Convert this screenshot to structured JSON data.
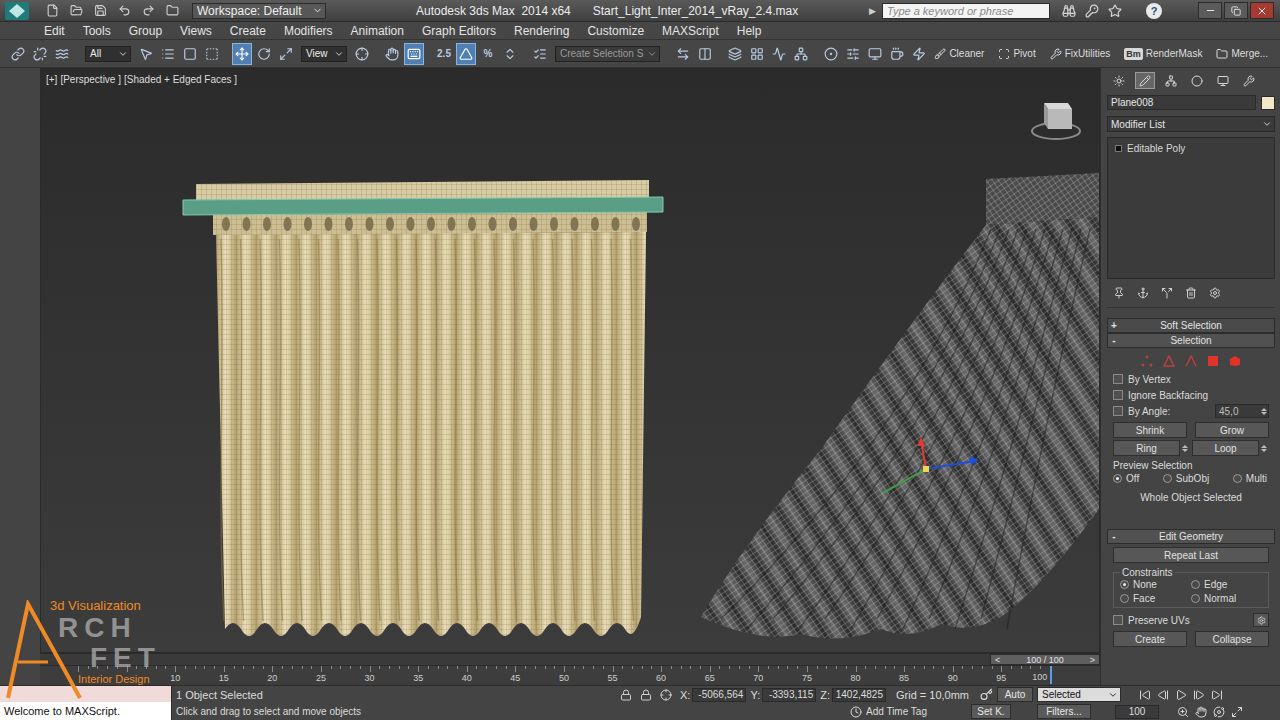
{
  "title_bar": {
    "workspace": "Workspace: Default",
    "app": "Autodesk 3ds Max  2014 x64",
    "file": "Start_Light_Inter_2014_vRay_2.4.max",
    "search_arrow": "▶",
    "search_placeholder": "Type a keyword or phrase",
    "help": "?"
  },
  "menu": [
    "Edit",
    "Tools",
    "Group",
    "Views",
    "Create",
    "Modifiers",
    "Animation",
    "Graph Editors",
    "Rendering",
    "Customize",
    "MAXScript",
    "Help"
  ],
  "toolbar": {
    "groups": [
      [
        {
          "kind": "icon",
          "selected": false
        },
        {
          "kind": "icon",
          "selected": false
        },
        {
          "kind": "icon",
          "selected": false
        }
      ],
      [
        {
          "kind": "dropdown",
          "label": "All"
        },
        {
          "kind": "icon",
          "selected": false
        },
        {
          "kind": "icon",
          "selected": false
        },
        {
          "kind": "icon",
          "selected": false
        },
        {
          "kind": "icon",
          "selected": false
        }
      ],
      [
        {
          "kind": "icon",
          "selected": true
        },
        {
          "kind": "icon",
          "selected": false
        },
        {
          "kind": "icon",
          "selected": false
        },
        {
          "kind": "dropdown",
          "label": "View"
        },
        {
          "kind": "icon",
          "selected": false
        }
      ],
      [
        {
          "kind": "icon",
          "selected": false
        },
        {
          "kind": "icon",
          "selected": true
        }
      ],
      [
        {
          "kind": "icon-text",
          "label": "2.5",
          "selected": false
        },
        {
          "kind": "icon",
          "selected": true
        },
        {
          "kind": "icon-text",
          "label": "%",
          "selected": false
        },
        {
          "kind": "icon",
          "selected": false
        }
      ],
      [
        {
          "kind": "icon",
          "selected": false
        },
        {
          "kind": "field",
          "label": "Create Selection S"
        }
      ],
      [
        {
          "kind": "icon",
          "selected": false
        },
        {
          "kind": "icon",
          "selected": false
        }
      ],
      [
        {
          "kind": "icon",
          "selected": false
        },
        {
          "kind": "icon",
          "selected": false
        },
        {
          "kind": "icon",
          "selected": false
        },
        {
          "kind": "icon",
          "selected": false
        }
      ],
      [
        {
          "kind": "icon",
          "selected": false
        },
        {
          "kind": "icon",
          "selected": false
        },
        {
          "kind": "icon",
          "selected": false
        },
        {
          "kind": "icon",
          "selected": false
        },
        {
          "kind": "icon",
          "selected": false
        }
      ]
    ],
    "plugins": [
      {
        "label": "Cleaner"
      },
      {
        "label": "Pivot"
      },
      {
        "label": "FixUtilities"
      },
      {
        "label": "RenderMask",
        "badge": "Bm"
      },
      {
        "label": "Merge..."
      }
    ]
  },
  "viewport": {
    "labels": [
      "[+]",
      "[Perspective ]",
      "[Shaded + Edged Faces ]"
    ]
  },
  "watermark": {
    "tagline": "3d Visualization",
    "line1": "RCH",
    "line2": "FET",
    "subtitle": "Interior Design"
  },
  "command_panel": {
    "tabs": [
      {
        "selected": false
      },
      {
        "selected": true
      },
      {
        "selected": false
      },
      {
        "selected": false
      },
      {
        "selected": false
      },
      {
        "selected": false
      }
    ],
    "object_name": "Plane008",
    "object_color": "#f3e8c8",
    "modifier_list": "Modifier List",
    "stack": [
      {
        "label": "Editable Poly",
        "selected": false
      }
    ],
    "soft_selection": {
      "sign": "+",
      "title": "Soft Selection",
      "expanded": false
    },
    "selection": {
      "sign": "-",
      "title": "Selection",
      "expanded": true,
      "subobjects": [
        {
          "selected": false
        },
        {
          "selected": false
        },
        {
          "selected": false
        },
        {
          "selected": false
        },
        {
          "selected": false
        }
      ],
      "options": [
        {
          "label": "By Vertex",
          "checked": false
        },
        {
          "label": "Ignore Backfacing",
          "checked": false
        },
        {
          "label": "By Angle:",
          "checked": false,
          "value": "45,0"
        }
      ],
      "grow_buttons": [
        "Shrink",
        "Grow"
      ],
      "loop_buttons": [
        "Ring",
        "Loop"
      ],
      "preview_label": "Preview Selection",
      "preview": [
        {
          "label": "Off",
          "selected": true
        },
        {
          "label": "SubObj",
          "selected": false
        },
        {
          "label": "Multi",
          "selected": false
        }
      ],
      "status": "Whole Object Selected"
    },
    "edit_geometry": {
      "sign": "-",
      "title": "Edit Geometry",
      "expanded": true,
      "repeat": "Repeat Last",
      "constraints_label": "Constraints",
      "constraints": [
        {
          "label": "None",
          "selected": true
        },
        {
          "label": "Edge",
          "selected": false
        },
        {
          "label": "Face",
          "selected": false
        },
        {
          "label": "Normal",
          "selected": false
        }
      ],
      "preserve_uvs": {
        "label": "Preserve UVs",
        "checked": false
      },
      "buttons": [
        "Create",
        "Collapse"
      ]
    }
  },
  "timeline": {
    "frame": "100 / 100",
    "level": 1,
    "prev": "<",
    "next": ">",
    "ticks": [
      "10",
      "15",
      "20",
      "25",
      "30",
      "35",
      "40",
      "45",
      "50",
      "55",
      "60",
      "65",
      "70",
      "75",
      "80",
      "85",
      "90",
      "95",
      "100"
    ]
  },
  "status_bar": {
    "listener": "Welcome to MAXScript.",
    "selection": "1 Object Selected",
    "prompt": "Click and drag to select and move objects",
    "coords": [
      {
        "axis": "X:",
        "value": "-5066,564"
      },
      {
        "axis": "Y:",
        "value": "-3393,115"
      },
      {
        "axis": "Z:",
        "value": "1402,4825"
      }
    ],
    "grid": "Grid = 10,0mm",
    "time_tag": "Add Time Tag",
    "auto_key": "Auto",
    "key_filter": "Selected",
    "set_key": "Set K.",
    "filters": "Filters...",
    "frame": "100"
  }
}
